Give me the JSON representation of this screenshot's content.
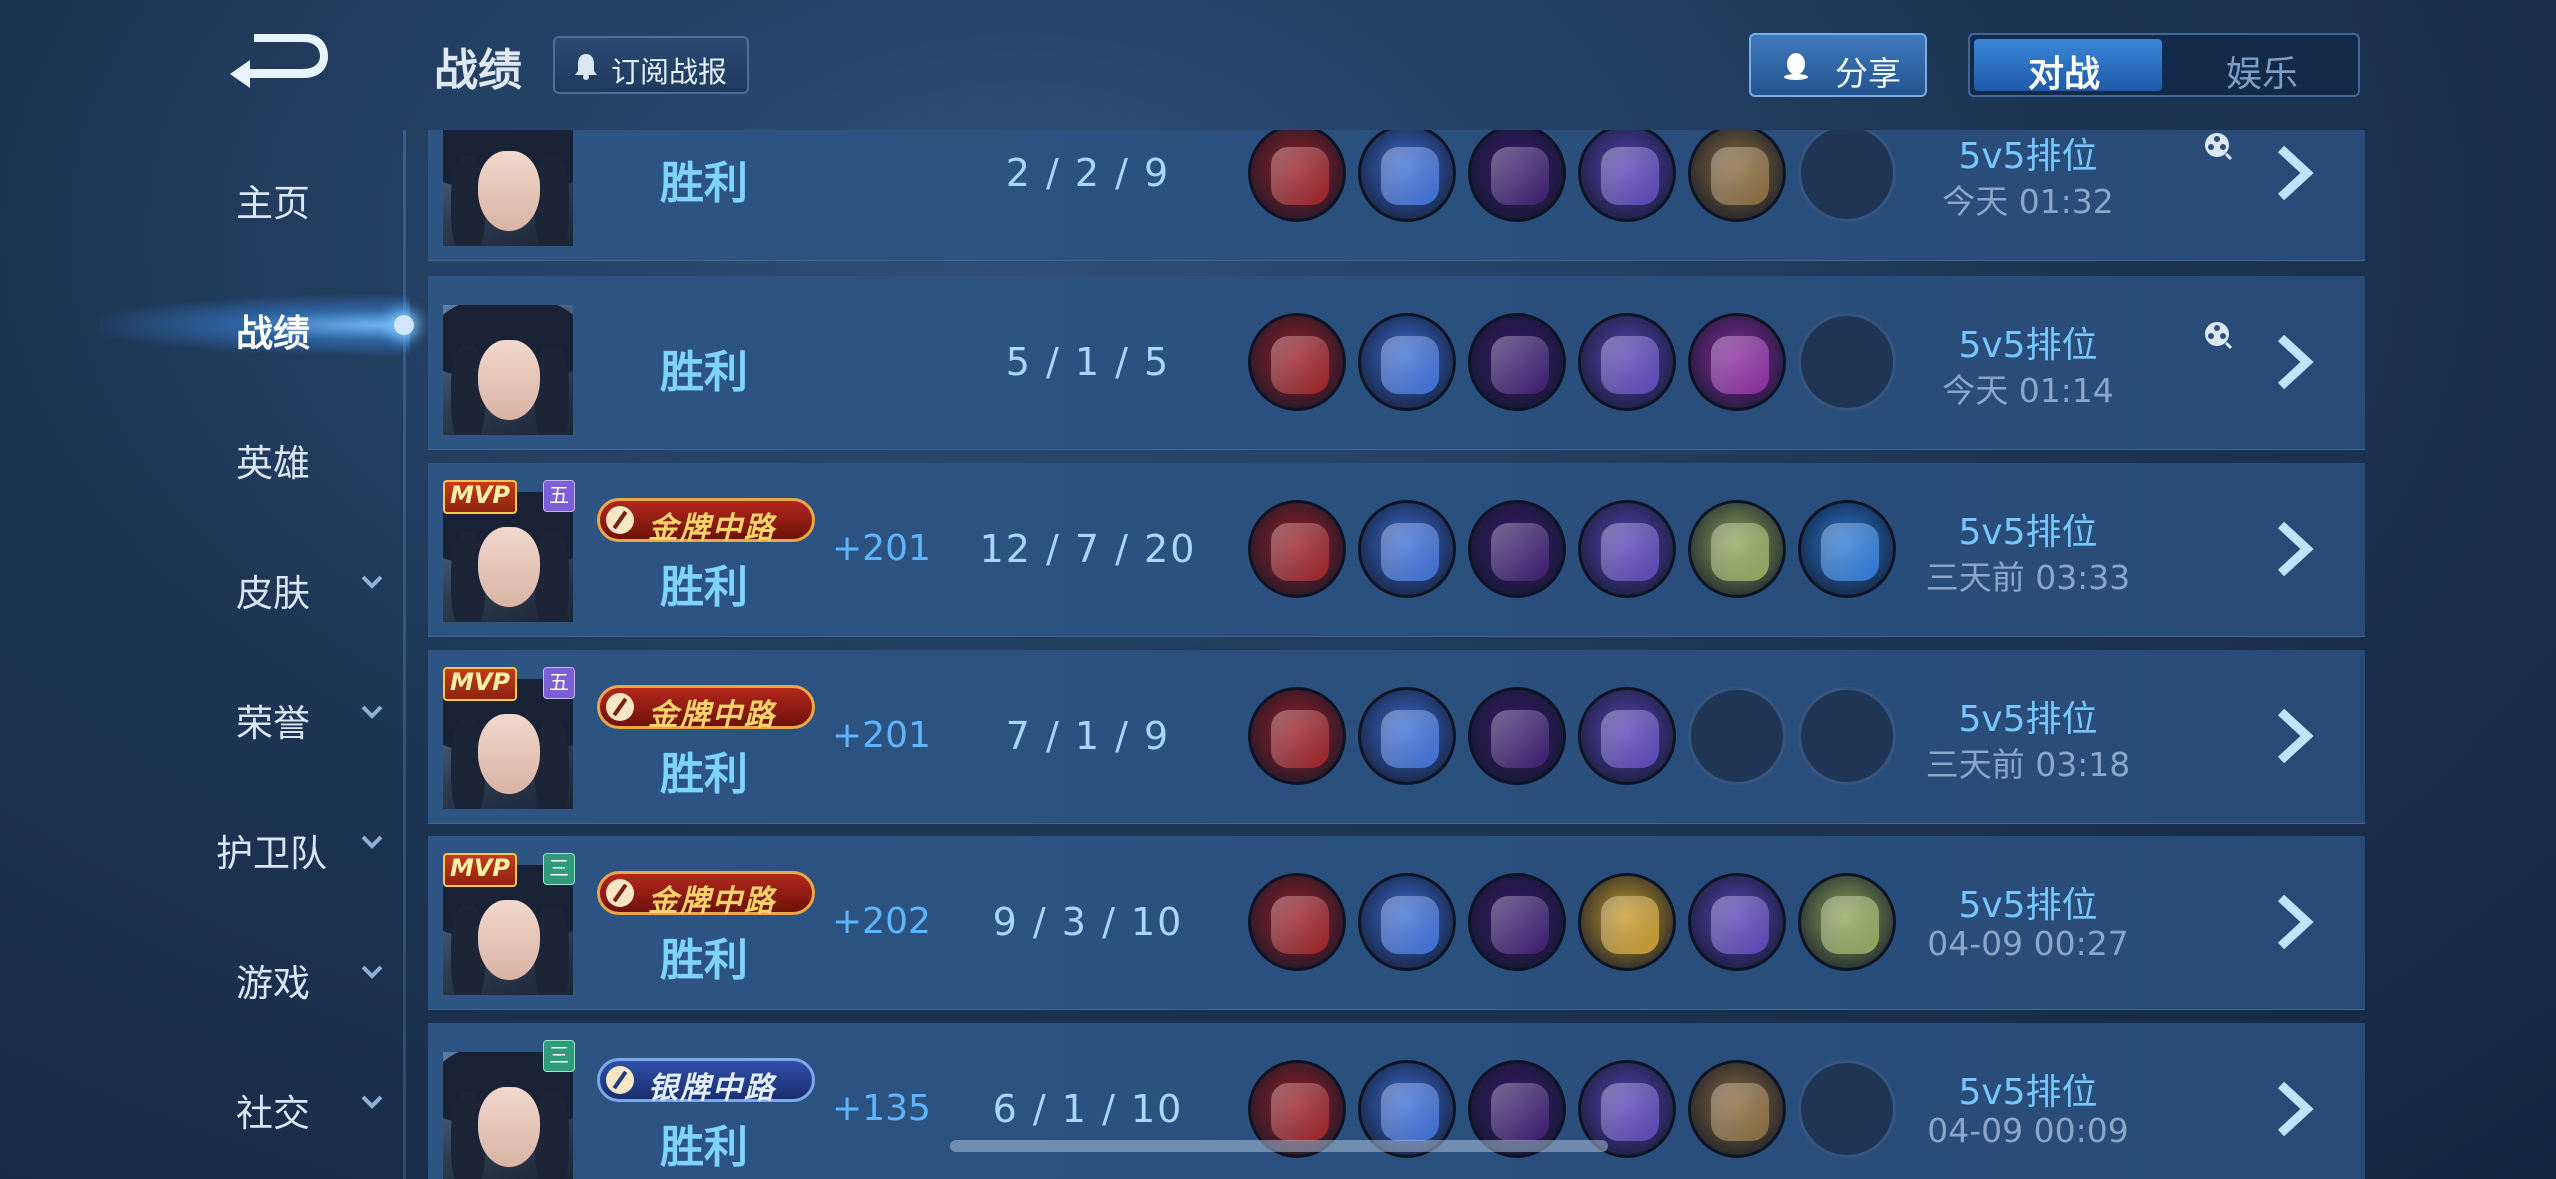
{
  "header": {
    "title": "战绩",
    "subscribe_label": "订阅战报",
    "share_label": "分享",
    "tabs": [
      {
        "label": "对战",
        "active": true
      },
      {
        "label": "娱乐",
        "active": false
      }
    ]
  },
  "sidebar": {
    "items": [
      {
        "label": "主页",
        "expandable": false,
        "active": false
      },
      {
        "label": "战绩",
        "expandable": false,
        "active": true
      },
      {
        "label": "英雄",
        "expandable": false,
        "active": false
      },
      {
        "label": "皮肤",
        "expandable": true,
        "active": false
      },
      {
        "label": "荣誉",
        "expandable": true,
        "active": false
      },
      {
        "label": "护卫队",
        "expandable": true,
        "active": false
      },
      {
        "label": "游戏",
        "expandable": true,
        "active": false
      },
      {
        "label": "社交",
        "expandable": true,
        "active": false
      }
    ]
  },
  "matches": [
    {
      "result": "胜利",
      "mvp": false,
      "tier": "",
      "medal": "",
      "score": "",
      "kda": "2 / 2 / 9",
      "mode": "5v5排位",
      "time": "今天 01:32",
      "replay": true,
      "items": [
        "red-boots",
        "blue-dragon",
        "red-hat",
        "purple-staff",
        "wooden-book",
        "empty"
      ]
    },
    {
      "result": "胜利",
      "mvp": false,
      "tier": "",
      "medal": "",
      "score": "",
      "kda": "5 / 1 / 5",
      "mode": "5v5排位",
      "time": "今天 01:14",
      "replay": true,
      "items": [
        "red-boots",
        "blue-dragon",
        "red-hat",
        "purple-staff",
        "magenta-rune",
        "empty"
      ]
    },
    {
      "result": "胜利",
      "mvp": true,
      "tier": "五",
      "medal": "金牌中路",
      "medal_type": "gold",
      "score": "+201",
      "kda": "12 / 7 / 20",
      "mode": "5v5排位",
      "time": "三天前 03:33",
      "replay": false,
      "items": [
        "red-boots",
        "blue-dragon",
        "red-hat",
        "purple-staff",
        "green-book",
        "blue-blade"
      ]
    },
    {
      "result": "胜利",
      "mvp": true,
      "tier": "五",
      "medal": "金牌中路",
      "medal_type": "gold",
      "score": "+201",
      "kda": "7 / 1 / 9",
      "mode": "5v5排位",
      "time": "三天前 03:18",
      "replay": false,
      "items": [
        "red-boots",
        "blue-dragon",
        "red-hat",
        "purple-staff",
        "empty",
        "empty"
      ]
    },
    {
      "result": "胜利",
      "mvp": true,
      "tier": "三",
      "medal": "金牌中路",
      "medal_type": "gold",
      "score": "+202",
      "kda": "9 / 3 / 10",
      "mode": "5v5排位",
      "time": "04-09  00:27",
      "replay": false,
      "items": [
        "red-boots",
        "blue-dragon",
        "red-hat",
        "gold-scepter",
        "purple-staff",
        "green-book"
      ]
    },
    {
      "result": "胜利",
      "mvp": false,
      "tier": "三",
      "medal": "银牌中路",
      "medal_type": "silver",
      "score": "+135",
      "kda": "6 / 1 / 10",
      "mode": "5v5排位",
      "time": "04-09  00:09",
      "replay": false,
      "items": [
        "red-boots",
        "blue-dragon",
        "red-hat",
        "purple-staff",
        "wooden-book",
        "empty"
      ]
    }
  ],
  "colors": {
    "red-boots": "#9c1f24",
    "blue-dragon": "#3c6fd8",
    "red-hat": "#3a1a6e",
    "purple-staff": "#5a44b8",
    "wooden-book": "#8a6a3a",
    "magenta-rune": "#8a2aa0",
    "green-book": "#8fa85a",
    "blue-blade": "#2a7ad8",
    "gold-scepter": "#c99a2a"
  }
}
